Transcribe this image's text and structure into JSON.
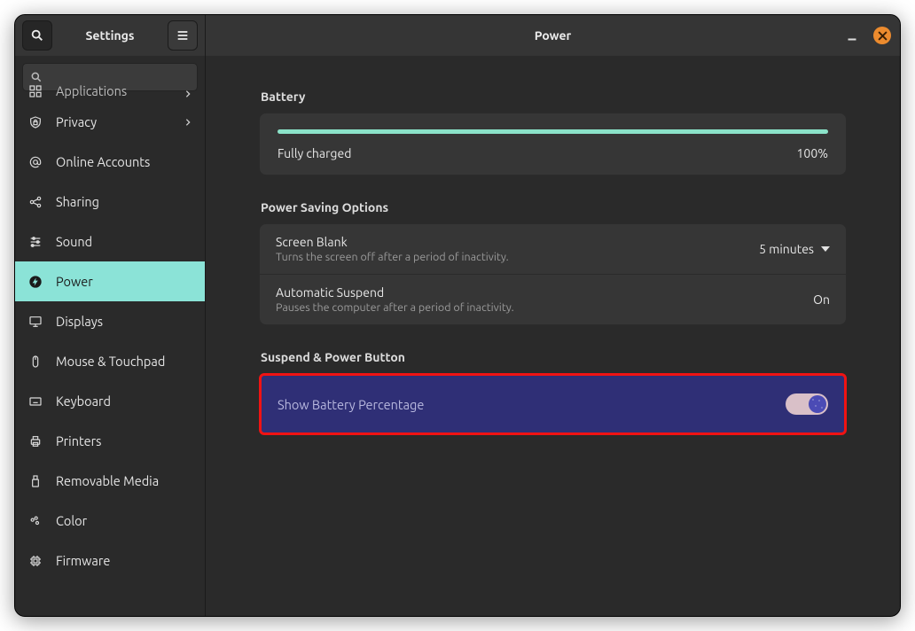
{
  "titlebar": {
    "left_title": "Settings",
    "right_title": "Power"
  },
  "search": {
    "placeholder": ""
  },
  "sidebar": {
    "items": [
      {
        "label": "Applications",
        "icon": "grid",
        "chevron": true,
        "cutoff": true
      },
      {
        "label": "Privacy",
        "icon": "shield-lock",
        "chevron": true
      },
      {
        "label": "Online Accounts",
        "icon": "at"
      },
      {
        "label": "Sharing",
        "icon": "share"
      },
      {
        "label": "Sound",
        "icon": "sliders"
      },
      {
        "label": "Power",
        "icon": "bolt",
        "active": true
      },
      {
        "label": "Displays",
        "icon": "display"
      },
      {
        "label": "Mouse & Touchpad",
        "icon": "mouse"
      },
      {
        "label": "Keyboard",
        "icon": "keyboard"
      },
      {
        "label": "Printers",
        "icon": "printer"
      },
      {
        "label": "Removable Media",
        "icon": "usb"
      },
      {
        "label": "Color",
        "icon": "palette"
      },
      {
        "label": "Firmware",
        "icon": "chip"
      }
    ]
  },
  "sections": {
    "battery": {
      "heading": "Battery",
      "status": "Fully charged",
      "percentage_text": "100%",
      "percentage_value": 100
    },
    "power_saving": {
      "heading": "Power Saving Options",
      "screen_blank": {
        "title": "Screen Blank",
        "subtitle": "Turns the screen off after a period of inactivity.",
        "value": "5 minutes"
      },
      "auto_suspend": {
        "title": "Automatic Suspend",
        "subtitle": "Pauses the computer after a period of inactivity.",
        "value": "On"
      }
    },
    "suspend": {
      "heading": "Suspend & Power Button",
      "battery_percentage": {
        "title": "Show Battery Percentage",
        "enabled": true
      }
    }
  }
}
